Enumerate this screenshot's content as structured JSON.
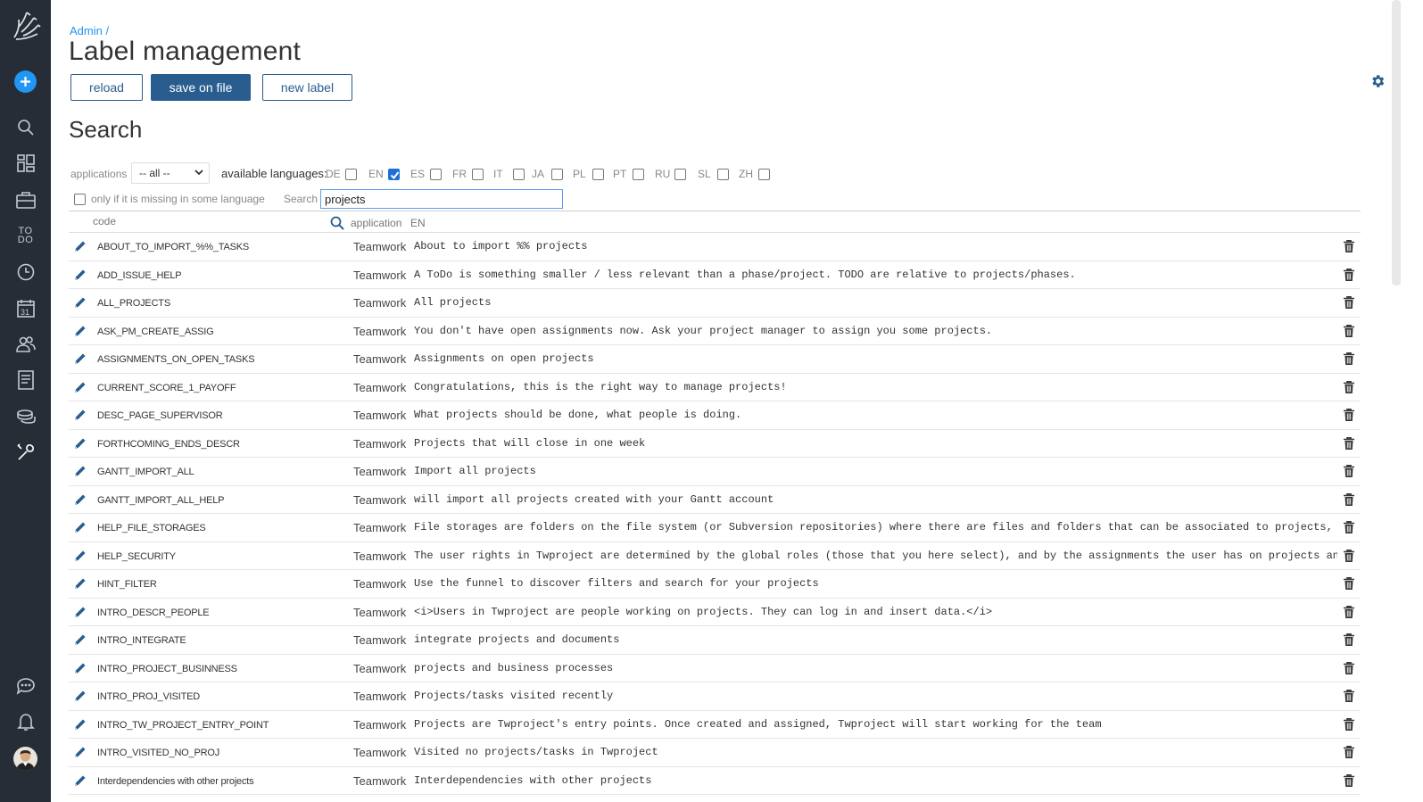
{
  "breadcrumb": "Admin /",
  "page_title": "Label management",
  "buttons": {
    "reload": "reload",
    "save": "save on file",
    "new_label": "new label"
  },
  "search_heading": "Search",
  "filters": {
    "applications_label": "applications",
    "applications_value": "-- all --",
    "available_languages_label": "available languages:",
    "languages": [
      {
        "code": "DE",
        "checked": false
      },
      {
        "code": "EN",
        "checked": true
      },
      {
        "code": "ES",
        "checked": false
      },
      {
        "code": "FR",
        "checked": false
      },
      {
        "code": "IT",
        "checked": false
      },
      {
        "code": "JA",
        "checked": false
      },
      {
        "code": "PL",
        "checked": false
      },
      {
        "code": "PT",
        "checked": false
      },
      {
        "code": "RU",
        "checked": false
      },
      {
        "code": "SL",
        "checked": false
      },
      {
        "code": "ZH",
        "checked": false
      }
    ],
    "missing_label": "only if it is missing in some language",
    "search_label": "Search",
    "search_value": "projects"
  },
  "table": {
    "col_code": "code",
    "col_application": "application",
    "col_lang": "EN",
    "rows": [
      {
        "code": "ABOUT_TO_IMPORT_%%_TASKS",
        "app": "Teamwork",
        "text": "About to import %% projects"
      },
      {
        "code": "ADD_ISSUE_HELP",
        "app": "Teamwork",
        "text": "A ToDo is something smaller / less relevant than a phase/project. TODO are relative to projects/phases."
      },
      {
        "code": "ALL_PROJECTS",
        "app": "Teamwork",
        "text": "All projects"
      },
      {
        "code": "ASK_PM_CREATE_ASSIG",
        "app": "Teamwork",
        "text": "You don't have open assignments now. Ask your project manager to assign you some projects."
      },
      {
        "code": "ASSIGNMENTS_ON_OPEN_TASKS",
        "app": "Teamwork",
        "text": "Assignments on open projects"
      },
      {
        "code": "CURRENT_SCORE_1_PAYOFF",
        "app": "Teamwork",
        "text": "Congratulations, this is the right way to manage projects!"
      },
      {
        "code": "DESC_PAGE_SUPERVISOR",
        "app": "Teamwork",
        "text": "What projects should be done, what people is doing."
      },
      {
        "code": "FORTHCOMING_ENDS_DESCR",
        "app": "Teamwork",
        "text": "Projects that will close in one week"
      },
      {
        "code": "GANTT_IMPORT_ALL",
        "app": "Teamwork",
        "text": "Import all projects"
      },
      {
        "code": "GANTT_IMPORT_ALL_HELP",
        "app": "Teamwork",
        "text": "will import all projects created with your Gantt account"
      },
      {
        "code": "HELP_FILE_STORAGES",
        "app": "Teamwork",
        "text": "File storages are folders on the file system (or Subversion repositories) where there are files and folders that can be associated to projects, by creating"
      },
      {
        "code": "HELP_SECURITY",
        "app": "Teamwork",
        "text": "The user rights in Twproject are determined by the global roles (those that you here select), and by the assignments the user has on projects and tasks, which"
      },
      {
        "code": "HINT_FILTER",
        "app": "Teamwork",
        "text": "Use the funnel to discover filters and search for your projects"
      },
      {
        "code": "INTRO_DESCR_PEOPLE",
        "app": "Teamwork",
        "text": "<i>Users in Twproject are people working on projects. They can log in and insert data.</i>"
      },
      {
        "code": "INTRO_INTEGRATE",
        "app": "Teamwork",
        "text": "integrate projects and documents"
      },
      {
        "code": "INTRO_PROJECT_BUSINNESS",
        "app": "Teamwork",
        "text": "projects and business processes"
      },
      {
        "code": "INTRO_PROJ_VISITED",
        "app": "Teamwork",
        "text": "Projects/tasks visited recently"
      },
      {
        "code": "INTRO_TW_PROJECT_ENTRY_POINT",
        "app": "Teamwork",
        "text": "Projects are Twproject's entry points. Once created and assigned, Twproject will start working for the team"
      },
      {
        "code": "INTRO_VISITED_NO_PROJ",
        "app": "Teamwork",
        "text": "Visited no projects/tasks in Twproject"
      },
      {
        "code": "Interdependencies with other projects",
        "app": "Teamwork",
        "text": "Interdependencies with other projects"
      }
    ]
  },
  "sidebar": {
    "items": [
      {
        "icon": "logo-icon"
      },
      {
        "icon": "add-icon"
      },
      {
        "icon": "search-icon"
      },
      {
        "icon": "dashboard-icon"
      },
      {
        "icon": "briefcase-icon"
      },
      {
        "icon": "todo-icon",
        "label": "TO\nDO"
      },
      {
        "icon": "clock-icon"
      },
      {
        "icon": "calendar-icon",
        "label": "31"
      },
      {
        "icon": "people-icon"
      },
      {
        "icon": "document-icon"
      },
      {
        "icon": "coins-icon"
      },
      {
        "icon": "tools-icon"
      },
      {
        "icon": "chat-icon"
      },
      {
        "icon": "bell-icon"
      },
      {
        "icon": "avatar-icon"
      }
    ]
  },
  "colors": {
    "sidebar_bg": "#262d36",
    "accent": "#2a5d8f",
    "link": "#2196f3",
    "checkbox": "#1e6fd9"
  }
}
